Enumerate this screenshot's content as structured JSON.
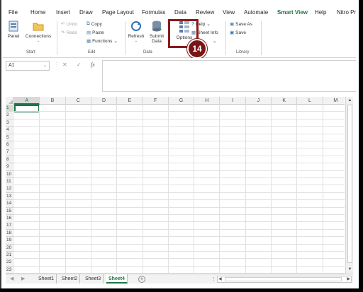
{
  "ribbon_tabs": [
    "File",
    "Home",
    "Insert",
    "Draw",
    "Page Layout",
    "Formulas",
    "Data",
    "Review",
    "View",
    "Automate",
    "Smart View",
    "Help",
    "Nitro Pr"
  ],
  "active_tab": "Smart View",
  "groups": {
    "start": {
      "label": "Start",
      "panel": "Panel",
      "connections": "Connections"
    },
    "edit": {
      "label": "Edit",
      "undo": "Undo",
      "redo": "Redo",
      "copy": "Copy",
      "paste": "Paste",
      "functions": "Functions"
    },
    "data": {
      "label": "Data",
      "refresh": "Refresh",
      "submit": "Submit Data",
      "options": "Options"
    },
    "help_group": {
      "help": "Help",
      "sheet_info": "Sheet Info"
    },
    "library": {
      "label": "Library",
      "save_as": "Save As",
      "save": "Save"
    }
  },
  "callout_badge": "14",
  "formula_bar": {
    "name_box": "A1",
    "fx": "fx",
    "cancel": "✕",
    "enter": "✓"
  },
  "columns": [
    "A",
    "B",
    "C",
    "D",
    "E",
    "F",
    "G",
    "H",
    "I",
    "J",
    "K",
    "L",
    "M"
  ],
  "rows": [
    "1",
    "2",
    "3",
    "4",
    "5",
    "6",
    "7",
    "8",
    "9",
    "10",
    "11",
    "12",
    "13",
    "14",
    "15",
    "16",
    "17",
    "18",
    "19",
    "20",
    "21",
    "22",
    "23"
  ],
  "sheet_tabs": [
    "Sheet1",
    "Sheet2",
    "Sheet3",
    "Sheet4"
  ],
  "active_sheet": "Sheet4",
  "colors": {
    "accent": "#217346",
    "highlight": "#8b1a1a"
  }
}
